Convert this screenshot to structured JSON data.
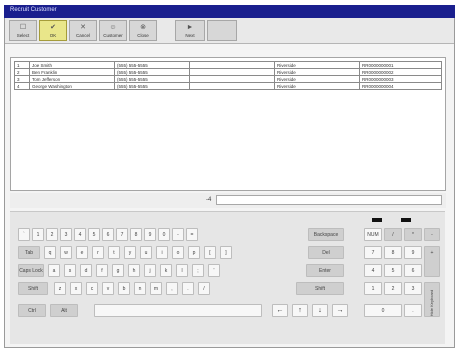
{
  "window": {
    "title": "Recruit Customer"
  },
  "toolbar": {
    "buttons": [
      {
        "label": "Select",
        "icon": "checkbox-icon",
        "active": false
      },
      {
        "label": "OK",
        "icon": "ok-icon",
        "active": true
      },
      {
        "label": "Cancel",
        "icon": "cancel-icon",
        "active": false
      },
      {
        "label": "Customer",
        "icon": "customer-icon",
        "active": false
      },
      {
        "label": "Close",
        "icon": "close-icon",
        "active": false
      },
      {
        "label": "Next",
        "icon": "next-icon",
        "active": false
      }
    ]
  },
  "records": [
    [
      "1",
      "Joe Smith",
      "(555) 555-5555",
      "",
      "Riverside",
      "RR0000000001"
    ],
    [
      "2",
      "Ben Franklin",
      "(555) 555-5555",
      "",
      "Riverside",
      "RR0000000002"
    ],
    [
      "3",
      "Tom Jefferson",
      "(555) 555-5555",
      "",
      "Riverside",
      "RR0000000003"
    ],
    [
      "4",
      "George Washington",
      "(555) 555-5555",
      "",
      "Riverside",
      "RR0000000004"
    ]
  ],
  "input": {
    "position_marker": "-4",
    "value": ""
  },
  "keyboard": {
    "row1": [
      "`",
      "1",
      "2",
      "3",
      "4",
      "5",
      "6",
      "7",
      "8",
      "9",
      "0",
      "-",
      "=",
      "Backspace"
    ],
    "row2": [
      "Tab",
      "q",
      "w",
      "e",
      "r",
      "t",
      "y",
      "u",
      "i",
      "o",
      "p",
      "[",
      "]",
      "Del"
    ],
    "row3": [
      "Caps Lock",
      "a",
      "s",
      "d",
      "f",
      "g",
      "h",
      "j",
      "k",
      "l",
      ";",
      "'",
      "Enter"
    ],
    "row4": [
      "Shift",
      "z",
      "x",
      "c",
      "v",
      "b",
      "n",
      "m",
      ",",
      ".",
      "/",
      "Shift"
    ],
    "row5": [
      "Ctrl",
      "Alt"
    ],
    "arrows": [
      "←",
      "↑",
      "↓",
      "→"
    ],
    "numpad": [
      [
        "NUM",
        "/",
        "*",
        "-"
      ],
      [
        "7",
        "8",
        "9",
        "+"
      ],
      [
        "4",
        "5",
        "6",
        ""
      ],
      [
        "1",
        "2",
        "3",
        "Enter"
      ],
      [
        "0",
        ".",
        "",
        ""
      ]
    ],
    "side_label": "Hide Keyboard"
  }
}
